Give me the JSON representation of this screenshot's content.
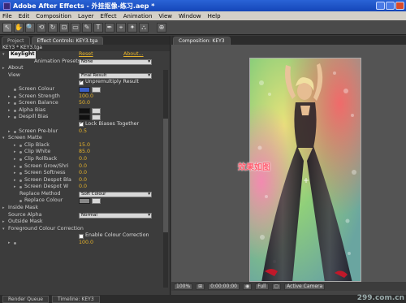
{
  "window": {
    "title": "Adobe After Effects - 外挂抠像-练习.aep *"
  },
  "menu": [
    "File",
    "Edit",
    "Composition",
    "Layer",
    "Effect",
    "Animation",
    "View",
    "Window",
    "Help"
  ],
  "toolbar": {
    "tools": [
      "↖",
      "✋",
      "🔍",
      "⟲",
      "↻",
      "⊡",
      "▭",
      "✎",
      "T",
      "✒",
      "⌖",
      "✦",
      "⛬"
    ],
    "extra": "⊕"
  },
  "left": {
    "tabs": [
      "Project",
      "Effect Controls: KEY3.tga"
    ],
    "subheader": "KEY3 * KEY3.tga",
    "effect": {
      "name": "Keylight",
      "reset": "Reset",
      "about": "About..."
    },
    "presets_label": "Animation Presets:",
    "presets_value": "None",
    "rows": [
      {
        "label": "About",
        "indent": 1,
        "arrow": "▸"
      },
      {
        "label": "View",
        "indent": 1,
        "select": "Final Result"
      },
      {
        "label": "",
        "indent": 1,
        "check": true,
        "checklbl": "Unpremultiply Result"
      },
      {
        "label": "Screen Colour",
        "indent": 2,
        "dot": true,
        "swatch": "#3a5fc8"
      },
      {
        "label": "Screen Strength",
        "indent": 2,
        "arrow": "▸",
        "dot": true,
        "val": "100.0"
      },
      {
        "label": "Screen Balance",
        "indent": 2,
        "arrow": "▸",
        "dot": true,
        "val": "50.0"
      },
      {
        "label": "Alpha Bias",
        "indent": 2,
        "arrow": "▸",
        "dot": true,
        "swatch": "#111"
      },
      {
        "label": "Despill Bias",
        "indent": 2,
        "arrow": "▸",
        "dot": true,
        "swatch": "#111"
      },
      {
        "label": "",
        "indent": 2,
        "check": true,
        "checklbl": "Lock Biases Together"
      },
      {
        "label": "Screen Pre-blur",
        "indent": 2,
        "arrow": "▸",
        "dot": true,
        "val": "0.5"
      },
      {
        "label": "Screen Matte",
        "indent": 1,
        "arrow": "▾"
      },
      {
        "label": "Clip Black",
        "indent": 3,
        "arrow": "▸",
        "dot": true,
        "val": "15.0"
      },
      {
        "label": "Clip White",
        "indent": 3,
        "arrow": "▸",
        "dot": true,
        "val": "85.0"
      },
      {
        "label": "Clip Rollback",
        "indent": 3,
        "arrow": "▸",
        "dot": true,
        "val": "0.0"
      },
      {
        "label": "Screen Grow/Shri",
        "indent": 3,
        "arrow": "▸",
        "dot": true,
        "val": "0.0"
      },
      {
        "label": "Screen Softness",
        "indent": 3,
        "arrow": "▸",
        "dot": true,
        "val": "0.0"
      },
      {
        "label": "Screen Despot Bla",
        "indent": 3,
        "arrow": "▸",
        "dot": true,
        "val": "0.0"
      },
      {
        "label": "Screen Despot W",
        "indent": 3,
        "arrow": "▸",
        "dot": true,
        "val": "0.0"
      },
      {
        "label": "Replace Method",
        "indent": 3,
        "select": "Soft Colour"
      },
      {
        "label": "Replace Colour",
        "indent": 3,
        "dot": true,
        "swatch": "#888"
      },
      {
        "label": "Inside Mask",
        "indent": 1,
        "arrow": "▸"
      },
      {
        "label": "Source Alpha",
        "indent": 1,
        "select": "Normal"
      },
      {
        "label": "Outside Mask",
        "indent": 1,
        "arrow": "▸"
      },
      {
        "label": "Foreground Colour Correction",
        "indent": 1,
        "arrow": "▾"
      },
      {
        "label": "",
        "indent": 2,
        "check": false,
        "checklbl": "Enable Colour Correction"
      },
      {
        "label": "",
        "indent": 2,
        "arrow": "▸",
        "dot": true,
        "val": "100.0"
      }
    ]
  },
  "right": {
    "tab": "Composition: KEY3",
    "zoom": "100%",
    "timecode": "0:00:00:00",
    "resolution": "Full",
    "camera": "Active Camera",
    "overlay": "效果如图"
  },
  "taskbar": {
    "items": [
      "Render Queue",
      "Timeline: KEY3"
    ],
    "watermark": "299.com.cn"
  },
  "colors": {
    "accent": "#e8b42a",
    "titlebar": "#2a63d6"
  }
}
